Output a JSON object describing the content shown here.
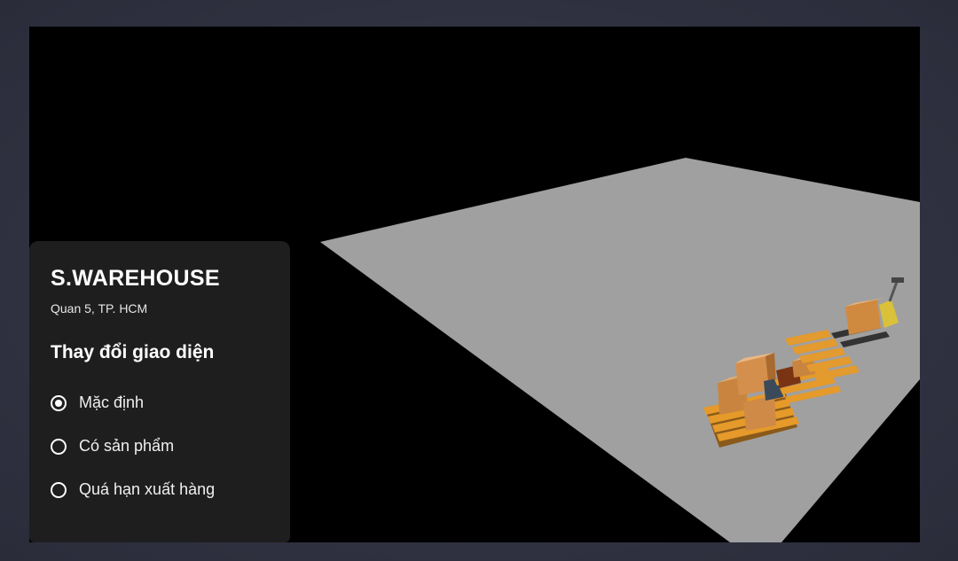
{
  "panel": {
    "brand": "S.WAREHOUSE",
    "address": "Quan 5, TP. HCM",
    "section_title": "Thay đổi giao diện",
    "options": [
      {
        "label": "Mặc định",
        "checked": true
      },
      {
        "label": "Có sản phẩm",
        "checked": false
      },
      {
        "label": "Quá hạn xuất hàng",
        "checked": false
      }
    ]
  },
  "colors": {
    "background": "#000000",
    "floor": "#a0a0a0",
    "panel": "#1e1e1e",
    "pallet": "#d98a1a",
    "box": "#d99a55",
    "forklift": "#d8c03a"
  },
  "icons": [
    "radio-checked-icon",
    "radio-unchecked-icon"
  ]
}
